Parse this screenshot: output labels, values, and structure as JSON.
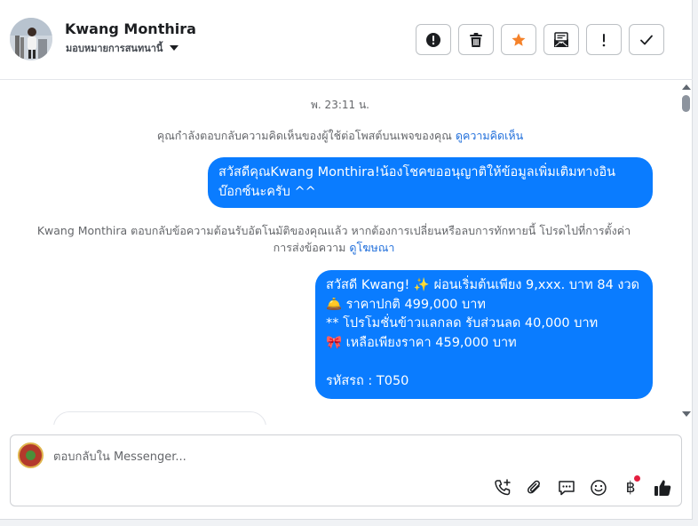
{
  "header": {
    "contact_name": "Kwang Monthira",
    "assign_label": "มอบหมายการสนทนานี้",
    "actions": [
      {
        "icon": "alert-circle-icon"
      },
      {
        "icon": "trash-icon"
      },
      {
        "icon": "star-icon"
      },
      {
        "icon": "mail-icon"
      },
      {
        "icon": "exclamation-icon"
      },
      {
        "icon": "check-icon"
      }
    ]
  },
  "stream": {
    "timestamp": "พ. 23:11 น.",
    "system_notice_1": {
      "text": "คุณกำลังตอบกลับความคิดเห็นของผู้ใช้ต่อโพสต์บนเพจของคุณ",
      "link": "ดูความคิดเห็น"
    },
    "bubble_1": {
      "lines": [
        "สวัสดีคุณKwang Monthira!น้องโชคขออนุญาติให้ข้อมูลเพิ่มเติมทางอิน",
        "บ๊อกซ์นะครับ ^^"
      ]
    },
    "system_notice_2": {
      "line1": "Kwang Monthira ตอบกลับข้อความต้อนรับอัตโนมัติของคุณแล้ว หากต้องการเปลี่ยนหรือลบการทักทายนี้ โปรดไปที่การตั้งค่า",
      "line2": "การส่งข้อความ",
      "link": "ดูโฆษณา"
    },
    "bubble_2": {
      "lines": [
        "สวัสดี Kwang! ✨  ผ่อนเริ่มต้นเพียง 9,xxx. บาท 84 งวด",
        "🛎️ ราคาปกติ 499,000 บาท",
        "** โปรโมชั่นข้าวแลกลด รับส่วนลด 40,000 บาท",
        "🎀  เหลือเพียงราคา 459,000 บาท",
        "",
        " รหัสรถ : T050"
      ]
    }
  },
  "composer": {
    "placeholder": "ตอบกลับใน Messenger...",
    "tools": [
      "phone-add-icon",
      "attachment-icon",
      "chat-bubble-icon",
      "emoji-icon",
      "baht-icon",
      "thumbs-up-icon"
    ],
    "baht_symbol": "฿"
  },
  "colors": {
    "bubble": "#0a7cff",
    "link": "#216fdb",
    "star": "#f5822a"
  }
}
